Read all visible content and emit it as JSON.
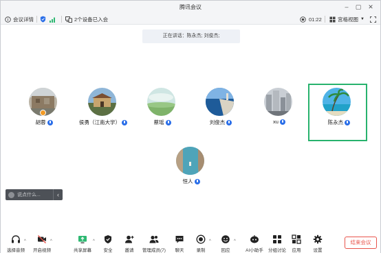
{
  "window": {
    "title": "腾讯会议",
    "controls": [
      "minimize",
      "maximize",
      "close"
    ]
  },
  "infobar": {
    "meeting_details": "会议详情",
    "devices_joined": "2个设备已入会",
    "timer": "01:22",
    "view_mode": "宫格视图"
  },
  "speaking": {
    "text": "正在讲话：陈永杰; 刘俊杰;"
  },
  "participants": [
    {
      "name": "胡蓉",
      "mic": "on",
      "host": true,
      "avatar": "wall-photo"
    },
    {
      "name": "侯勇（江南大学）",
      "mic": "on",
      "host": false,
      "avatar": "building-photo"
    },
    {
      "name": "蔡瑶",
      "mic": "on",
      "host": false,
      "avatar": "grassland-photo"
    },
    {
      "name": "刘俊杰",
      "mic": "speaking",
      "host": false,
      "avatar": "sea-photo"
    },
    {
      "name": "xu",
      "mic": "on",
      "host": false,
      "avatar": "city-photo"
    },
    {
      "name": "陈永杰",
      "mic": "speaking",
      "host": false,
      "avatar": "beach-photo",
      "active": true
    },
    {
      "name": "恒人",
      "mic": "on",
      "host": false,
      "avatar": "lake-photo"
    }
  ],
  "chat": {
    "placeholder": "说点什么..."
  },
  "toolbar": {
    "items": [
      {
        "label": "选择音频",
        "icon": "headset-icon",
        "caret": true
      },
      {
        "label": "开启视频",
        "icon": "camera-off-icon",
        "caret": true
      },
      {
        "label": "共享屏幕",
        "icon": "share-screen-icon",
        "caret": true
      },
      {
        "label": "安全",
        "icon": "shield-icon",
        "caret": false
      },
      {
        "label": "邀请",
        "icon": "invite-icon",
        "caret": false
      },
      {
        "label": "管理成员(7)",
        "icon": "members-icon",
        "caret": false
      },
      {
        "label": "聊天",
        "icon": "chat-icon",
        "caret": false
      },
      {
        "label": "录制",
        "icon": "record-icon",
        "caret": true
      },
      {
        "label": "回应",
        "icon": "react-icon",
        "caret": true
      },
      {
        "label": "AI小助手",
        "icon": "ai-assistant-icon",
        "caret": false
      },
      {
        "label": "分组讨论",
        "icon": "breakout-icon",
        "caret": false
      },
      {
        "label": "应用",
        "icon": "apps-icon",
        "caret": false
      },
      {
        "label": "设置",
        "icon": "gear-icon",
        "caret": false
      }
    ],
    "end_meeting": "结束会议"
  },
  "colors": {
    "accent_blue": "#2a6ee8",
    "active_border": "#27b26d",
    "end_red": "#e8534a",
    "signal_green": "#2eb872"
  }
}
